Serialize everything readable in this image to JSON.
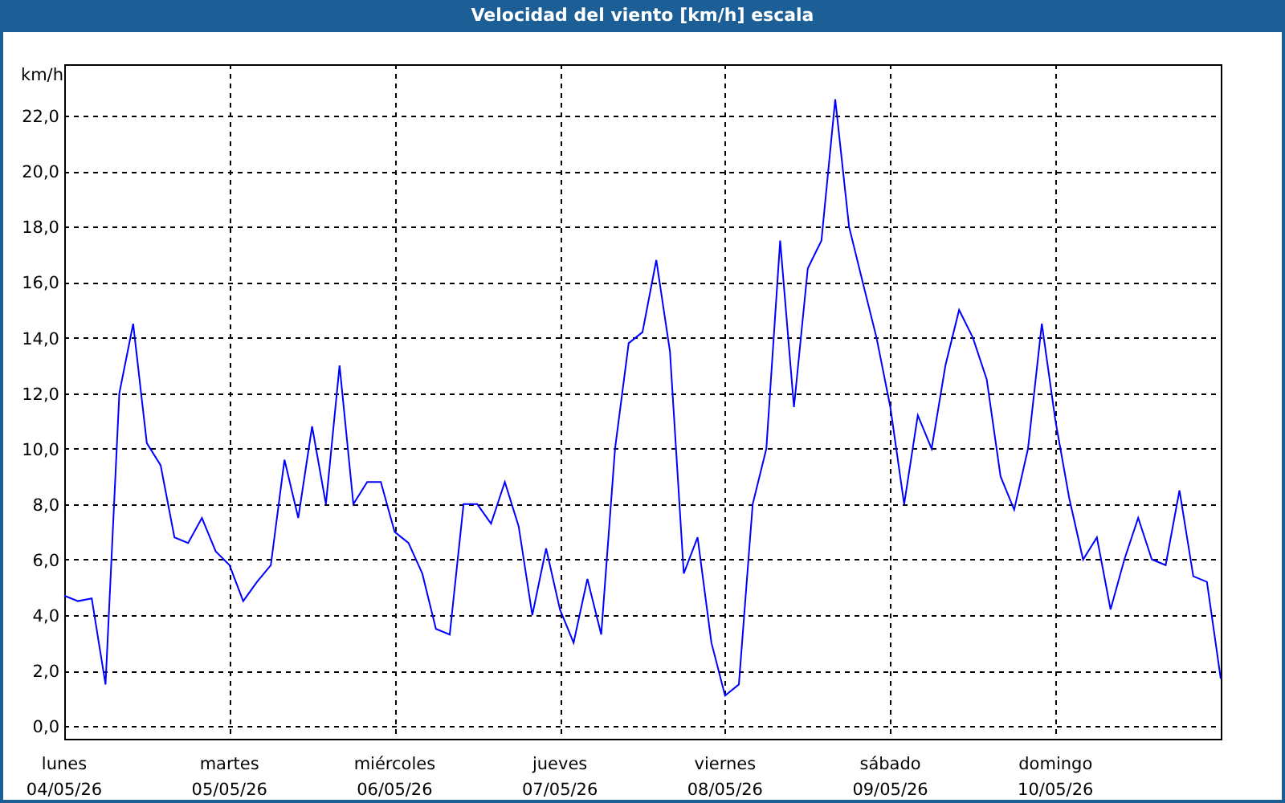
{
  "window": {
    "title": "Velocidad del viento [km/h] escala"
  },
  "chart": {
    "chart_data": {
      "type": "line",
      "ylabel": "km/h",
      "categories": [
        "04/05/26",
        null,
        null,
        null,
        null,
        null,
        null,
        null,
        null,
        null,
        null,
        null,
        "05/05/26",
        null,
        null,
        null,
        null,
        null,
        null,
        null,
        null,
        null,
        null,
        null,
        "06/05/26",
        null,
        null,
        null,
        null,
        null,
        null,
        null,
        null,
        null,
        null,
        null,
        "07/05/26",
        null,
        null,
        null,
        null,
        null,
        null,
        null,
        null,
        null,
        null,
        null,
        "08/05/26",
        null,
        null,
        null,
        null,
        null,
        null,
        null,
        null,
        null,
        null,
        null,
        "09/05/26",
        null,
        null,
        null,
        null,
        null,
        null,
        null,
        null,
        null,
        null,
        null,
        "10/05/26",
        null,
        null,
        null,
        null,
        null,
        null,
        null,
        null,
        null,
        null,
        null,
        null
      ],
      "series": [
        {
          "color": "#0000ff",
          "values": [
            4.7,
            4.5,
            4.6,
            1.5,
            12.0,
            14.5,
            10.2,
            9.4,
            6.8,
            6.6,
            7.5,
            6.3,
            5.8,
            4.5,
            5.2,
            5.8,
            9.6,
            7.5,
            10.8,
            8.0,
            13.0,
            8.0,
            8.8,
            8.8,
            7.0,
            6.6,
            5.5,
            3.5,
            3.3,
            8.0,
            8.0,
            7.3,
            8.8,
            7.2,
            4.0,
            6.4,
            4.2,
            3.0,
            5.3,
            3.3,
            10.0,
            13.8,
            14.2,
            16.8,
            13.5,
            5.5,
            6.8,
            3.0,
            1.1,
            1.5,
            8.0,
            10.0,
            17.5,
            11.5,
            16.5,
            17.5,
            22.6,
            18.0,
            16.0,
            14.0,
            11.5,
            8.0,
            11.2,
            10.0,
            13.0,
            15.0,
            14.0,
            12.5,
            9.0,
            7.8,
            10.0,
            14.5,
            11.0,
            8.2,
            6.0,
            6.8,
            4.2,
            6.0,
            7.5,
            6.0,
            5.8,
            8.5,
            5.4,
            5.2,
            1.7
          ]
        }
      ],
      "grid": true,
      "ylim": [
        -0.46,
        23.86
      ],
      "yticks": [
        {
          "value": 0,
          "label": "0,0"
        },
        {
          "value": 2,
          "label": "2,0"
        },
        {
          "value": 4,
          "label": "4,0"
        },
        {
          "value": 6,
          "label": "6,0"
        },
        {
          "value": 8,
          "label": "8,0"
        },
        {
          "value": 10,
          "label": "10,0"
        },
        {
          "value": 12,
          "label": "12,0"
        },
        {
          "value": 14,
          "label": "14,0"
        },
        {
          "value": 16,
          "label": "16,0"
        },
        {
          "value": 18,
          "label": "18,0"
        },
        {
          "value": 20,
          "label": "20,0"
        },
        {
          "value": 22,
          "label": "22,0"
        }
      ]
    },
    "xtick_days": [
      "lunes",
      "martes",
      "miércoles",
      "jueves",
      "viernes",
      "sábado",
      "domingo"
    ]
  }
}
